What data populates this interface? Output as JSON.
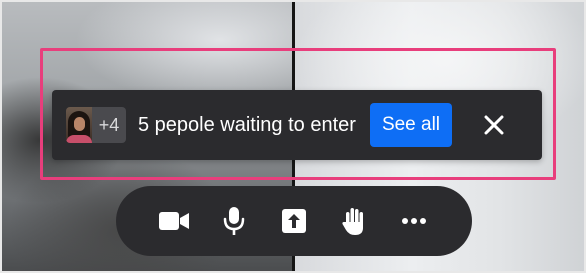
{
  "banner": {
    "extra_count": "+4",
    "message": "5 pepole waiting to enter",
    "see_all_label": "See all",
    "avatar_icon": "participant-avatar",
    "close_icon": "close-icon"
  },
  "toolbar": {
    "items": [
      {
        "name": "camera",
        "icon": "video-camera-icon"
      },
      {
        "name": "microphone",
        "icon": "microphone-icon"
      },
      {
        "name": "share-screen",
        "icon": "share-screen-icon"
      },
      {
        "name": "raise-hand",
        "icon": "raise-hand-icon"
      },
      {
        "name": "more",
        "icon": "more-options-icon"
      }
    ]
  },
  "colors": {
    "banner_bg": "#2b2b2e",
    "primary_button": "#0e6ef5",
    "highlight_border": "#e83e7c",
    "count_bg": "#4a4a4e"
  }
}
